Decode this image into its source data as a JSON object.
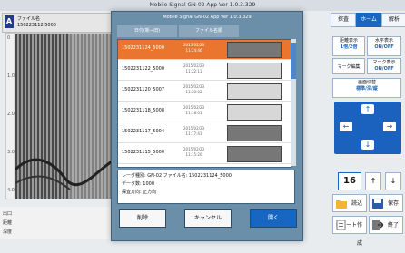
{
  "window": {
    "title": "Mobile Signal GN-02 App  Ver 1.0.3.329"
  },
  "left": {
    "header_line1": "ファイル名",
    "header_line2": "150223112  5000",
    "ruler": [
      "0",
      "",
      "1.0",
      "",
      "2.0",
      "",
      "3.0",
      "",
      "4.0"
    ],
    "bottom_labels": [
      "出口",
      "距離",
      "深度"
    ]
  },
  "dialog": {
    "tabs": [
      "日付(新→旧)",
      "ファイル名順"
    ],
    "files": [
      {
        "name": "1502231124_5000",
        "date": "2015/02/23\n11:24:46",
        "selected": true,
        "thumb": "dark"
      },
      {
        "name": "1502231122_5000",
        "date": "2015/02/23\n11:22:11",
        "selected": false,
        "thumb": "light"
      },
      {
        "name": "1502231120_5007",
        "date": "2015/02/23\n11:20:02",
        "selected": false,
        "thumb": "light"
      },
      {
        "name": "1502231118_5008",
        "date": "2015/02/23\n11:18:01",
        "selected": false,
        "thumb": "light"
      },
      {
        "name": "1502231117_5004",
        "date": "2015/02/23\n11:17:43",
        "selected": false,
        "thumb": "dark"
      },
      {
        "name": "1502231115_5000",
        "date": "2015/02/23\n11:15:20",
        "selected": false,
        "thumb": "dark"
      }
    ],
    "info": [
      "レーダ種別: GN-02   ファイル名: 1502231124_5000",
      "データ数: 1000",
      "探査方向: 正方向"
    ],
    "buttons": {
      "delete": "削除",
      "cancel": "キャンセル",
      "open": "開く"
    }
  },
  "right": {
    "tabs": [
      "探査",
      "ホーム",
      "解析"
    ],
    "buttons": [
      {
        "top": "距離表示",
        "bottom": "1倍/2倍"
      },
      {
        "top": "水平表示",
        "bottom": "ON/OFF"
      },
      {
        "top": "マーク編集",
        "bottom": ""
      },
      {
        "top": "マーク表示",
        "bottom": "ON/OFF"
      }
    ],
    "display_select": {
      "label": "画面切替",
      "options": "標準/深/縦",
      "selected": "標準"
    },
    "arrows": {
      "up": "↑",
      "down": "↓",
      "left": "←",
      "right": "→"
    },
    "number": "16",
    "small_up": "↑",
    "small_down": "↓",
    "files": {
      "read": "読込",
      "save": "保存",
      "report": "レポート作成",
      "exit": "終了"
    }
  }
}
